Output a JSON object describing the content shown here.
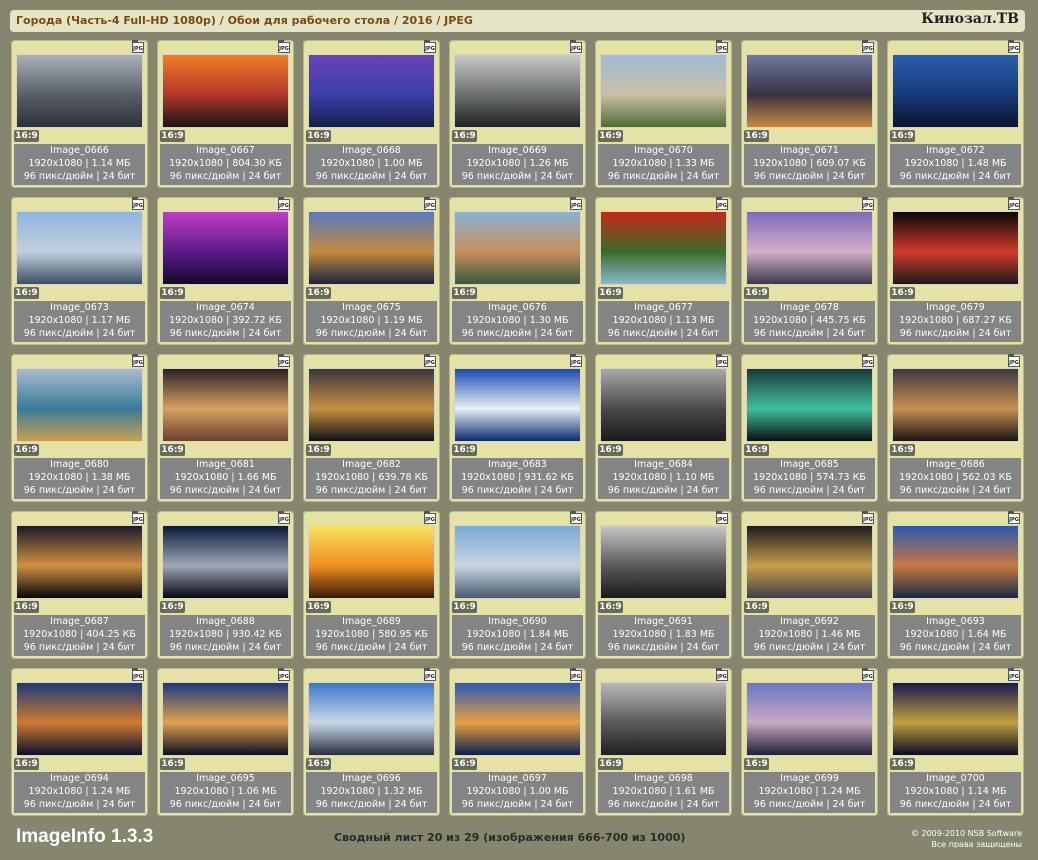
{
  "header": {
    "title": "Города (Часть-4 Full-HD 1080p) / Обои для рабочего стола / 2016 / JPEG",
    "brand": "Кинозал.ТВ"
  },
  "tile_common": {
    "ratio": "16:9",
    "format": "JPG",
    "dpi_line": "96 пикс/дюйм | 24 бит"
  },
  "images": [
    {
      "name": "Image_0666",
      "dims": "1920x1080 | 1.14 МБ",
      "colors": [
        "#a9b0ba",
        "#59606a",
        "#2c3038"
      ]
    },
    {
      "name": "Image_0667",
      "dims": "1920x1080 | 804.30 КБ",
      "colors": [
        "#f27d24",
        "#b3372a",
        "#1a1416"
      ]
    },
    {
      "name": "Image_0668",
      "dims": "1920x1080 | 1.00 МБ",
      "colors": [
        "#6a43b8",
        "#3b3fa8",
        "#172048"
      ]
    },
    {
      "name": "Image_0669",
      "dims": "1920x1080 | 1.26 МБ",
      "colors": [
        "#c7c9c9",
        "#6d7070",
        "#202222"
      ]
    },
    {
      "name": "Image_0670",
      "dims": "1920x1080 | 1.33 МБ",
      "colors": [
        "#9dbbd8",
        "#c9c0a2",
        "#516a38"
      ]
    },
    {
      "name": "Image_0671",
      "dims": "1920x1080 | 609.07 КБ",
      "colors": [
        "#6e7aa0",
        "#3a3144",
        "#c88c40"
      ]
    },
    {
      "name": "Image_0672",
      "dims": "1920x1080 | 1.48 МБ",
      "colors": [
        "#2b5fb0",
        "#183a78",
        "#0a1430"
      ]
    },
    {
      "name": "Image_0673",
      "dims": "1920x1080 | 1.17 МБ",
      "colors": [
        "#8fb6e0",
        "#c4cfdc",
        "#3a5068"
      ]
    },
    {
      "name": "Image_0674",
      "dims": "1920x1080 | 392.72 КБ",
      "colors": [
        "#c13cc8",
        "#5a1c8a",
        "#120a2a"
      ]
    },
    {
      "name": "Image_0675",
      "dims": "1920x1080 | 1.19 МБ",
      "colors": [
        "#5a7ac0",
        "#c48a3c",
        "#1a2440"
      ]
    },
    {
      "name": "Image_0676",
      "dims": "1920x1080 | 1.30 МБ",
      "colors": [
        "#87b3d6",
        "#c88e58",
        "#3a5a40"
      ]
    },
    {
      "name": "Image_0677",
      "dims": "1920x1080 | 1.13 МБ",
      "colors": [
        "#c42a1a",
        "#3a6a2a",
        "#8abacc"
      ]
    },
    {
      "name": "Image_0678",
      "dims": "1920x1080 | 445.75 КБ",
      "colors": [
        "#7e6ab8",
        "#d4b0c8",
        "#3a3a4a"
      ]
    },
    {
      "name": "Image_0679",
      "dims": "1920x1080 | 687.27 КБ",
      "colors": [
        "#080808",
        "#d23a2a",
        "#1a1a1a"
      ]
    },
    {
      "name": "Image_0680",
      "dims": "1920x1080 | 1.38 МБ",
      "colors": [
        "#a8bcd0",
        "#3a7a9a",
        "#c8a050"
      ]
    },
    {
      "name": "Image_0681",
      "dims": "1920x1080 | 1.66 МБ",
      "colors": [
        "#2a2028",
        "#d8a060",
        "#6a4030"
      ]
    },
    {
      "name": "Image_0682",
      "dims": "1920x1080 | 639.78 КБ",
      "colors": [
        "#3a3840",
        "#c89040",
        "#101018"
      ]
    },
    {
      "name": "Image_0683",
      "dims": "1920x1080 | 931.62 КБ",
      "colors": [
        "#1a4ab0",
        "#e8f0f8",
        "#0a2a70"
      ]
    },
    {
      "name": "Image_0684",
      "dims": "1920x1080 | 1.10 МБ",
      "colors": [
        "#a8a8a8",
        "#4a4a4a",
        "#1a1a1a"
      ]
    },
    {
      "name": "Image_0685",
      "dims": "1920x1080 | 574.73 КБ",
      "colors": [
        "#1a3a3a",
        "#40c0a0",
        "#0a1010"
      ]
    },
    {
      "name": "Image_0686",
      "dims": "1920x1080 | 562.03 КБ",
      "colors": [
        "#3a3a40",
        "#c89050",
        "#1a1414"
      ]
    },
    {
      "name": "Image_0687",
      "dims": "1920x1080 | 404.25 КБ",
      "colors": [
        "#1a1a28",
        "#d09040",
        "#06060c"
      ]
    },
    {
      "name": "Image_0688",
      "dims": "1920x1080 | 930.42 КБ",
      "colors": [
        "#0a1a3a",
        "#a0a8b8",
        "#05080f"
      ]
    },
    {
      "name": "Image_0689",
      "dims": "1920x1080 | 580.95 КБ",
      "colors": [
        "#f8e060",
        "#f09020",
        "#3a1a08"
      ]
    },
    {
      "name": "Image_0690",
      "dims": "1920x1080 | 1.84 МБ",
      "colors": [
        "#7aa8d8",
        "#c8d4e0",
        "#4a5a70"
      ]
    },
    {
      "name": "Image_0691",
      "dims": "1920x1080 | 1.83 МБ",
      "colors": [
        "#c8c8c8",
        "#5a5a5a",
        "#1a1a1a"
      ]
    },
    {
      "name": "Image_0692",
      "dims": "1920x1080 | 1.46 МБ",
      "colors": [
        "#1a1a20",
        "#c8a048",
        "#40404a"
      ]
    },
    {
      "name": "Image_0693",
      "dims": "1920x1080 | 1.64 МБ",
      "colors": [
        "#2a5ab0",
        "#c87840",
        "#1a2a48"
      ]
    },
    {
      "name": "Image_0694",
      "dims": "1920x1080 | 1.24 МБ",
      "colors": [
        "#1a3a7a",
        "#d07a30",
        "#0a1030"
      ]
    },
    {
      "name": "Image_0695",
      "dims": "1920x1080 | 1.06 МБ",
      "colors": [
        "#1a3a80",
        "#e0a050",
        "#0a1020"
      ]
    },
    {
      "name": "Image_0696",
      "dims": "1920x1080 | 1.32 МБ",
      "colors": [
        "#3a78c8",
        "#c8d8e8",
        "#2a3040"
      ]
    },
    {
      "name": "Image_0697",
      "dims": "1920x1080 | 1.00 МБ",
      "colors": [
        "#2a5ab8",
        "#e8a040",
        "#0a2050"
      ]
    },
    {
      "name": "Image_0698",
      "dims": "1920x1080 | 1.61 МБ",
      "colors": [
        "#b8b8b8",
        "#5a5a5a",
        "#202020"
      ]
    },
    {
      "name": "Image_0699",
      "dims": "1920x1080 | 1.24 МБ",
      "colors": [
        "#6a78c8",
        "#c8a8c0",
        "#20203a"
      ]
    },
    {
      "name": "Image_0700",
      "dims": "1920x1080 | 1.14 МБ",
      "colors": [
        "#1a1a50",
        "#c0a040",
        "#0a0a20"
      ]
    }
  ],
  "footer": {
    "logo": "ImageInfo 1.3.3",
    "status": "Сводный лист 20 из 29 (изображения 666-700 из 1000)",
    "copyright_line1": "© 2009-2010 NSB Software",
    "copyright_line2": "Все права защищены"
  }
}
